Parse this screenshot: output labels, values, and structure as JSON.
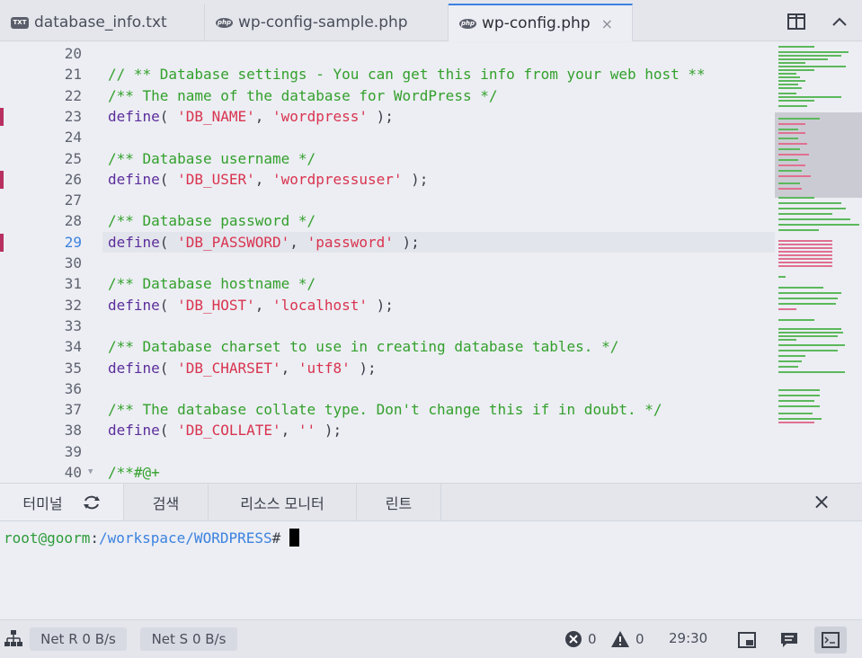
{
  "tabs": [
    {
      "icon": "TXT",
      "label": "database_info.txt"
    },
    {
      "icon": "php",
      "label": "wp-config-sample.php"
    },
    {
      "icon": "php",
      "label": "wp-config.php",
      "close": "×"
    }
  ],
  "editor": {
    "lines": [
      {
        "n": "20",
        "t": []
      },
      {
        "n": "21",
        "t": [
          [
            "c-com",
            "// ** Database settings - You can get this info from your web host **"
          ]
        ]
      },
      {
        "n": "22",
        "t": [
          [
            "c-com",
            "/** The name of the database for WordPress */"
          ]
        ]
      },
      {
        "n": "23",
        "mark": true,
        "t": [
          [
            "c-fn",
            "define"
          ],
          [
            "c-pun",
            "( "
          ],
          [
            "c-str",
            "'DB_NAME'"
          ],
          [
            "c-pun",
            ", "
          ],
          [
            "c-str",
            "'wordpress'"
          ],
          [
            "c-pun",
            " );"
          ]
        ]
      },
      {
        "n": "24",
        "t": []
      },
      {
        "n": "25",
        "t": [
          [
            "c-com",
            "/** Database username */"
          ]
        ]
      },
      {
        "n": "26",
        "mark": true,
        "t": [
          [
            "c-fn",
            "define"
          ],
          [
            "c-pun",
            "( "
          ],
          [
            "c-str",
            "'DB_USER'"
          ],
          [
            "c-pun",
            ", "
          ],
          [
            "c-str",
            "'wordpressuser'"
          ],
          [
            "c-pun",
            " );"
          ]
        ]
      },
      {
        "n": "27",
        "t": []
      },
      {
        "n": "28",
        "t": [
          [
            "c-com",
            "/** Database password */"
          ]
        ]
      },
      {
        "n": "29",
        "mark": true,
        "current": true,
        "t": [
          [
            "c-fn",
            "define"
          ],
          [
            "c-pun",
            "( "
          ],
          [
            "c-str",
            "'DB_PASSWORD'"
          ],
          [
            "c-pun",
            ", "
          ],
          [
            "c-str",
            "'password'"
          ],
          [
            "c-pun",
            " );"
          ]
        ]
      },
      {
        "n": "30",
        "t": []
      },
      {
        "n": "31",
        "t": [
          [
            "c-com",
            "/** Database hostname */"
          ]
        ]
      },
      {
        "n": "32",
        "t": [
          [
            "c-fn",
            "define"
          ],
          [
            "c-pun",
            "( "
          ],
          [
            "c-str",
            "'DB_HOST'"
          ],
          [
            "c-pun",
            ", "
          ],
          [
            "c-str",
            "'localhost'"
          ],
          [
            "c-pun",
            " );"
          ]
        ]
      },
      {
        "n": "33",
        "t": []
      },
      {
        "n": "34",
        "t": [
          [
            "c-com",
            "/** Database charset to use in creating database tables. */"
          ]
        ]
      },
      {
        "n": "35",
        "t": [
          [
            "c-fn",
            "define"
          ],
          [
            "c-pun",
            "( "
          ],
          [
            "c-str",
            "'DB_CHARSET'"
          ],
          [
            "c-pun",
            ", "
          ],
          [
            "c-str",
            "'utf8'"
          ],
          [
            "c-pun",
            " );"
          ]
        ]
      },
      {
        "n": "36",
        "t": []
      },
      {
        "n": "37",
        "t": [
          [
            "c-com",
            "/** The database collate type. Don't change this if in doubt. */"
          ]
        ]
      },
      {
        "n": "38",
        "t": [
          [
            "c-fn",
            "define"
          ],
          [
            "c-pun",
            "( "
          ],
          [
            "c-str",
            "'DB_COLLATE'"
          ],
          [
            "c-pun",
            ", "
          ],
          [
            "c-str",
            "''"
          ],
          [
            "c-pun",
            " );"
          ]
        ]
      },
      {
        "n": "39",
        "t": []
      },
      {
        "n": "40",
        "fold": true,
        "t": [
          [
            "c-com",
            "/**#@+"
          ]
        ]
      }
    ]
  },
  "panel": {
    "tabs": [
      "터미널",
      "검색",
      "리소스 모니터",
      "린트"
    ],
    "close": "×"
  },
  "terminal": {
    "user": "root@goorm",
    "sep": ":",
    "path": "/workspace/WORDPRESS",
    "symbol": "#"
  },
  "status": {
    "net_r": "Net R 0 B/s",
    "net_s": "Net S 0 B/s",
    "errors": "0",
    "warnings": "0",
    "position": "29:30"
  },
  "colors": {
    "accent": "#3c82e0",
    "comment": "#33a02c",
    "string": "#d9334f",
    "keyword": "#5b2d9b",
    "marker": "#b83060"
  }
}
